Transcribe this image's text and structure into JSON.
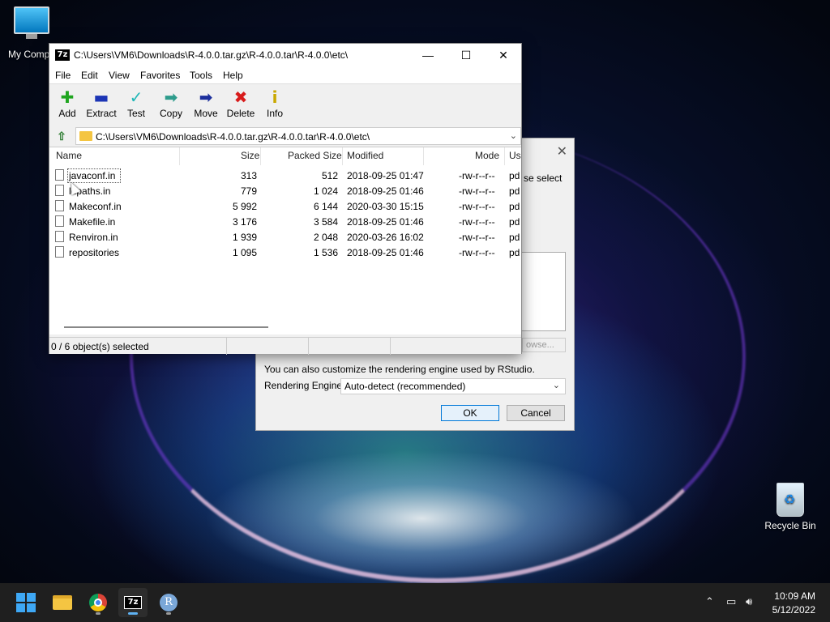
{
  "desktop": {
    "icons": [
      {
        "label": "My Compu"
      },
      {
        "label": "Recycle Bin"
      }
    ]
  },
  "rstudio_dialog": {
    "partial_text": "se select",
    "browse_label": "owse...",
    "note": "You can also customize the rendering engine used by RStudio.",
    "engine_label": "Rendering Engine:",
    "engine_value": "Auto-detect (recommended)",
    "ok_label": "OK",
    "cancel_label": "Cancel"
  },
  "sevenzip": {
    "title": "C:\\Users\\VM6\\Downloads\\R-4.0.0.tar.gz\\R-4.0.0.tar\\R-4.0.0\\etc\\",
    "app_icon": "7z",
    "menu": [
      "File",
      "Edit",
      "View",
      "Favorites",
      "Tools",
      "Help"
    ],
    "toolbar": [
      {
        "label": "Add",
        "icon": "plus-icon",
        "glyph": "✚",
        "color": "#1fa51f"
      },
      {
        "label": "Extract",
        "icon": "minus-icon",
        "glyph": "▬",
        "color": "#1c35b5"
      },
      {
        "label": "Test",
        "icon": "check-icon",
        "glyph": "✓",
        "color": "#20b7b7"
      },
      {
        "label": "Copy",
        "icon": "copy-arrow-icon",
        "glyph": "➡",
        "color": "#2e9c8c"
      },
      {
        "label": "Move",
        "icon": "move-arrow-icon",
        "glyph": "➡",
        "color": "#1c2f9c"
      },
      {
        "label": "Delete",
        "icon": "delete-x-icon",
        "glyph": "✖",
        "color": "#d81b1b"
      },
      {
        "label": "Info",
        "icon": "info-icon",
        "glyph": "i",
        "color": "#c9a800"
      }
    ],
    "path": "C:\\Users\\VM6\\Downloads\\R-4.0.0.tar.gz\\R-4.0.0.tar\\R-4.0.0\\etc\\",
    "columns": [
      "Name",
      "Size",
      "Packed Size",
      "Modified",
      "Mode",
      "Us"
    ],
    "files": [
      {
        "name": "javaconf.in",
        "size": "313",
        "packed": "512",
        "modified": "2018-09-25 01:47",
        "mode": "-rw-r--r--",
        "user": "pd"
      },
      {
        "name": "ldpaths.in",
        "size": "779",
        "packed": "1 024",
        "modified": "2018-09-25 01:46",
        "mode": "-rw-r--r--",
        "user": "pd"
      },
      {
        "name": "Makeconf.in",
        "size": "5 992",
        "packed": "6 144",
        "modified": "2020-03-30 15:15",
        "mode": "-rw-r--r--",
        "user": "pd"
      },
      {
        "name": "Makefile.in",
        "size": "3 176",
        "packed": "3 584",
        "modified": "2018-09-25 01:46",
        "mode": "-rw-r--r--",
        "user": "pd"
      },
      {
        "name": "Renviron.in",
        "size": "1 939",
        "packed": "2 048",
        "modified": "2020-03-26 16:02",
        "mode": "-rw-r--r--",
        "user": "pd"
      },
      {
        "name": "repositories",
        "size": "1 095",
        "packed": "1 536",
        "modified": "2018-09-25 01:46",
        "mode": "-rw-r--r--",
        "user": "pd"
      }
    ],
    "status": "0 / 6 object(s) selected"
  },
  "taskbar": {
    "time": "10:09 AM",
    "date": "5/12/2022",
    "apps": [
      "start-button",
      "file-explorer",
      "chrome",
      "7-zip",
      "r-gui"
    ],
    "tray_icons": [
      "chevron-up-icon",
      "network-icon",
      "volume-icon"
    ]
  }
}
